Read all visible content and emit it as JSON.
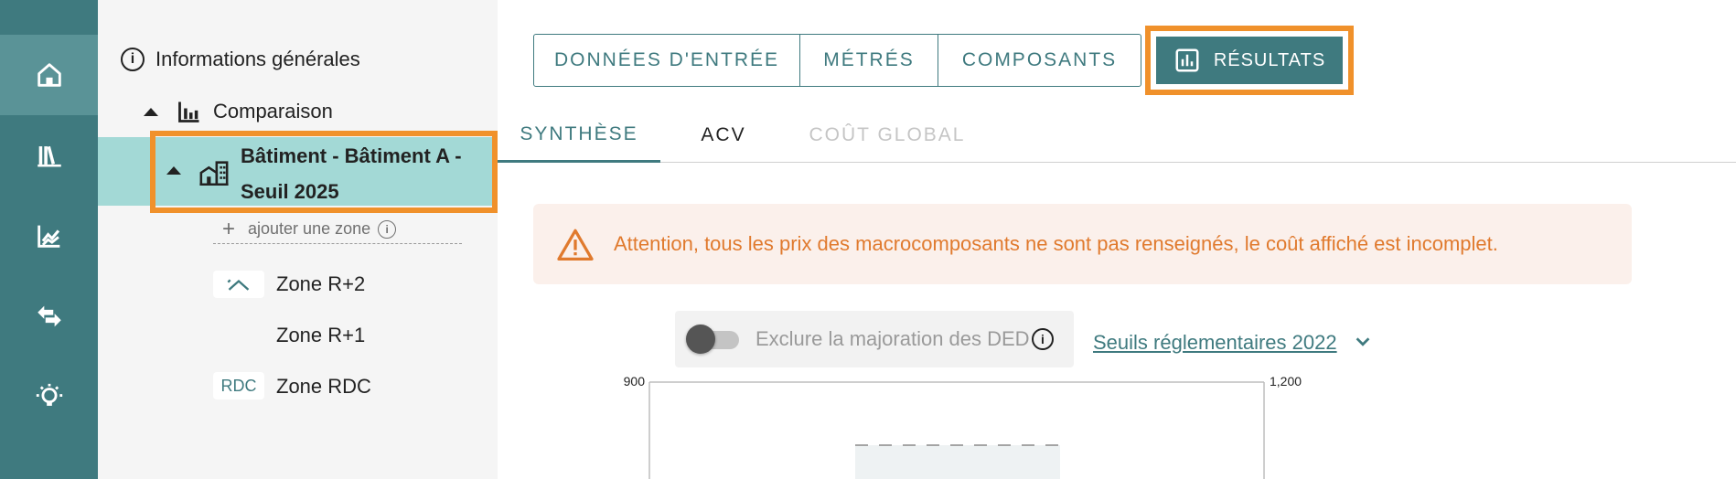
{
  "rail": {
    "items": [
      {
        "icon": "home-icon",
        "active": true
      },
      {
        "icon": "library-icon",
        "active": false
      },
      {
        "icon": "analytics-icon",
        "active": false
      },
      {
        "icon": "swap-arrows-icon",
        "active": false
      },
      {
        "icon": "lightbulb-icon",
        "active": false
      }
    ]
  },
  "tree": {
    "general_info": "Informations générales",
    "comparison": "Comparaison",
    "selected_building": "Bâtiment - Bâtiment A - Seuil 2025",
    "add_zone": "ajouter une zone",
    "zones": [
      {
        "badge": "",
        "badge_icon": "zone-roof-icon",
        "label": "Zone R+2"
      },
      {
        "badge": "",
        "badge_icon": "",
        "label": "Zone R+1"
      },
      {
        "badge": "RDC",
        "badge_icon": "",
        "label": "Zone RDC"
      }
    ]
  },
  "main": {
    "top_buttons": [
      {
        "label": "DONNÉES D'ENTRÉE"
      },
      {
        "label": "MÉTRÉS"
      },
      {
        "label": "COMPOSANTS"
      }
    ],
    "results_button": "RÉSULTATS",
    "subtabs": [
      {
        "label": "SYNTHÈSE",
        "state": "active"
      },
      {
        "label": "ACV",
        "state": "normal"
      },
      {
        "label": "COÛT GLOBAL",
        "state": "disabled"
      }
    ],
    "alert_text": "Attention, tous les prix des macrocomposants ne sont pas renseignés, le coût affiché est incomplet.",
    "toggle": {
      "label": "Exclure la majoration des DED",
      "checked": false
    },
    "seuils_link": "Seuils réglementaires 2022"
  },
  "colors": {
    "primary": "#3f7a7f",
    "highlight": "#f0912b",
    "selected_bg": "#a3d9d6",
    "warning": "#e07a2e",
    "warning_bg": "#fbf0eb"
  },
  "chart_data": {
    "type": "bar",
    "left_axis_top_label": "900",
    "right_axis_top_label": "1,200",
    "bars": [
      {
        "category": "",
        "value": null,
        "threshold_dashed": true
      }
    ]
  }
}
